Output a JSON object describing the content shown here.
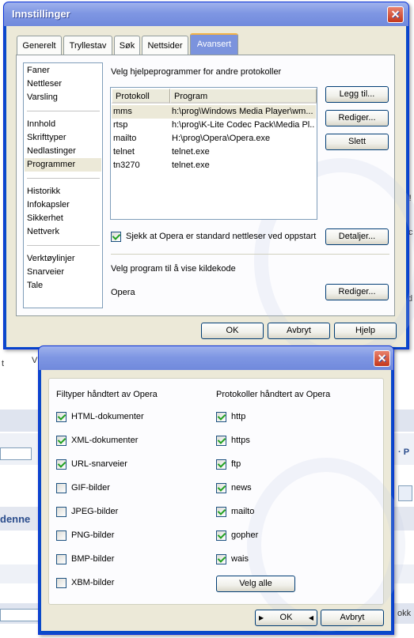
{
  "background": {
    "snippets": [
      "t",
      "r!",
      "d",
      "· P",
      "denne",
      "okk",
      "V",
      "c"
    ]
  },
  "main_dialog": {
    "title": "Innstillinger",
    "close_glyph": "✕",
    "tabs": [
      {
        "label": "Generelt",
        "active": false
      },
      {
        "label": "Tryllestav",
        "active": false
      },
      {
        "label": "Søk",
        "active": false
      },
      {
        "label": "Nettsider",
        "active": false
      },
      {
        "label": "Avansert",
        "active": true
      }
    ],
    "sidebar": {
      "groups": [
        [
          "Faner",
          "Nettleser",
          "Varsling"
        ],
        [
          "Innhold",
          "Skrifttyper",
          "Nedlastinger",
          "Programmer"
        ],
        [
          "Historikk",
          "Infokapsler",
          "Sikkerhet",
          "Nettverk"
        ],
        [
          "Verktøylinjer",
          "Snarveier",
          "Tale"
        ]
      ],
      "selected": "Programmer"
    },
    "helper_heading": "Velg hjelpeprogrammer for andre protokoller",
    "table": {
      "columns": [
        "Protokoll",
        "Program"
      ],
      "rows": [
        {
          "protocol": "mms",
          "program": "h:\\prog\\Windows Media Player\\wm...",
          "selected": true
        },
        {
          "protocol": "rtsp",
          "program": "h:\\prog\\K-Lite Codec Pack\\Media Pl...",
          "selected": false
        },
        {
          "protocol": "mailto",
          "program": "H:\\prog\\Opera\\Opera.exe",
          "selected": false
        },
        {
          "protocol": "telnet",
          "program": "telnet.exe",
          "selected": false
        },
        {
          "protocol": "tn3270",
          "program": "telnet.exe",
          "selected": false
        }
      ]
    },
    "buttons": {
      "add": "Legg til...",
      "edit": "Rediger...",
      "delete": "Slett",
      "details": "Detaljer...",
      "edit_source": "Rediger...",
      "ok": "OK",
      "cancel": "Avbryt",
      "help": "Hjelp"
    },
    "default_check": {
      "label": "Sjekk at Opera er standard nettleser ved oppstart",
      "checked": true
    },
    "source_heading": "Velg program til å vise kildekode",
    "source_program": "Opera"
  },
  "sub_dialog": {
    "close_glyph": "✕",
    "filetypes_heading": "Filtyper håndtert av Opera",
    "protocols_heading": "Protokoller håndtert av Opera",
    "filetypes": [
      {
        "label": "HTML-dokumenter",
        "checked": true
      },
      {
        "label": "XML-dokumenter",
        "checked": true
      },
      {
        "label": "URL-snarveier",
        "checked": true
      },
      {
        "label": "GIF-bilder",
        "checked": false
      },
      {
        "label": "JPEG-bilder",
        "checked": false
      },
      {
        "label": "PNG-bilder",
        "checked": false
      },
      {
        "label": "BMP-bilder",
        "checked": false
      },
      {
        "label": "XBM-bilder",
        "checked": false
      }
    ],
    "protocols": [
      {
        "label": "http",
        "checked": true
      },
      {
        "label": "https",
        "checked": true
      },
      {
        "label": "ftp",
        "checked": true
      },
      {
        "label": "news",
        "checked": true
      },
      {
        "label": "mailto",
        "checked": true
      },
      {
        "label": "gopher",
        "checked": true
      },
      {
        "label": "wais",
        "checked": true
      }
    ],
    "buttons": {
      "select_all": "Velg alle",
      "ok": "OK",
      "cancel": "Avbryt"
    }
  },
  "colors": {
    "title_bar": "#7f97e3",
    "window_frame": "#0a49c9",
    "client": "#ece9d8",
    "close": "#d2462a"
  }
}
